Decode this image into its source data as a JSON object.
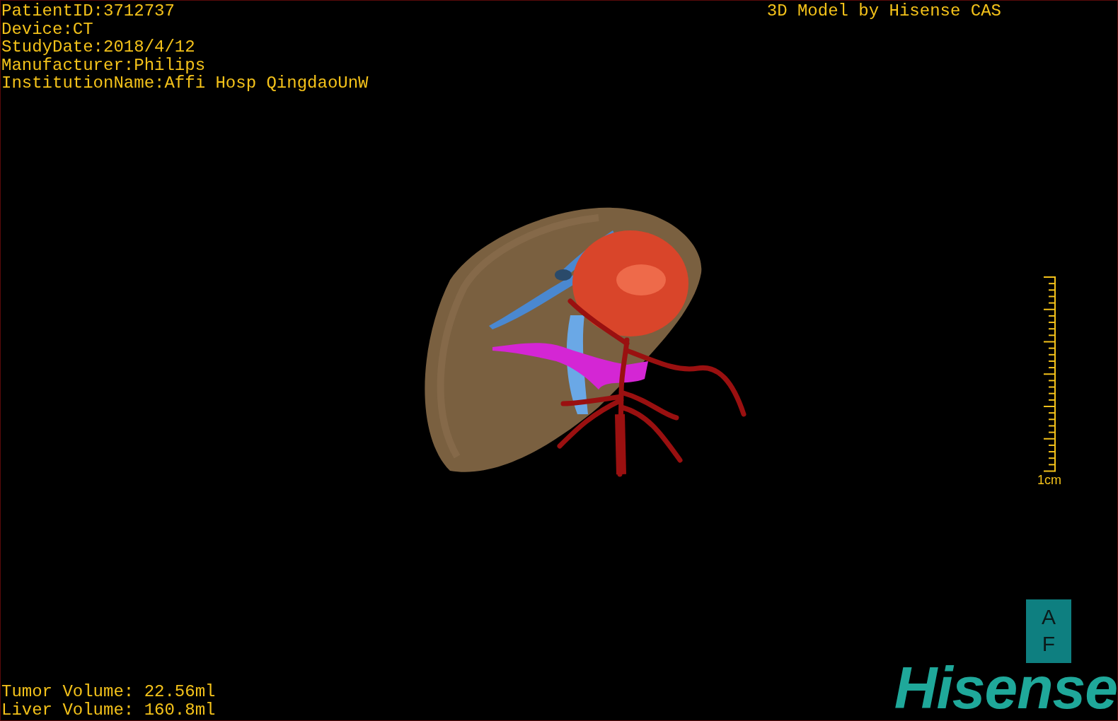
{
  "patient_info": [
    "PatientID:3712737",
    "Device:CT",
    "StudyDate:2018/4/12",
    "Manufacturer:Philips",
    "InstitutionName:Affi Hosp QingdaoUnW"
  ],
  "title": "3D Model by Hisense CAS",
  "scale_bar": {
    "label": "1cm"
  },
  "orientation_cube": {
    "top": "A",
    "bottom": "F"
  },
  "volumes": [
    "Tumor Volume: 22.56ml",
    "Liver Volume: 160.8ml"
  ],
  "logo": "Hisense"
}
